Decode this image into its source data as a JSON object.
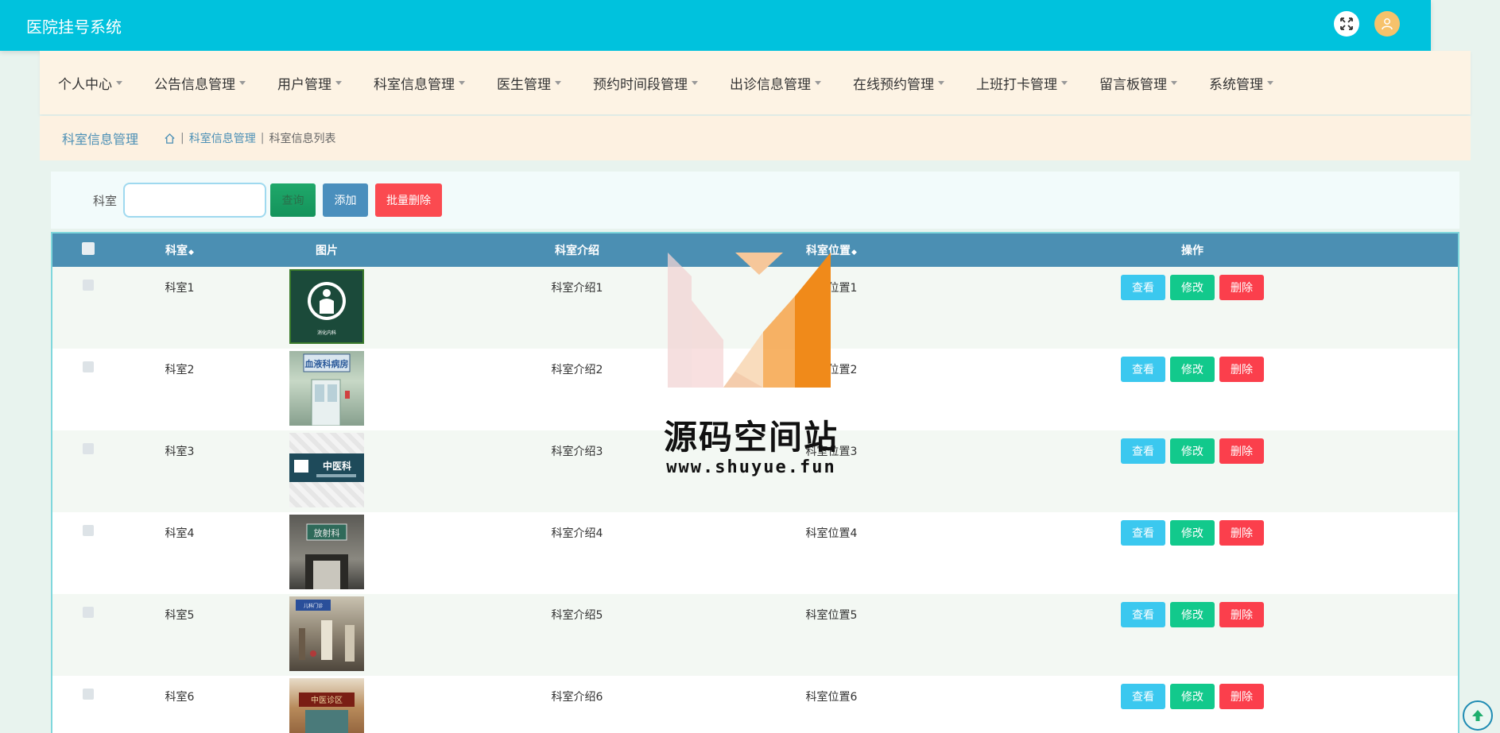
{
  "header": {
    "app_title": "医院挂号系统"
  },
  "menu": {
    "items": [
      {
        "label": "个人中心"
      },
      {
        "label": "公告信息管理"
      },
      {
        "label": "用户管理"
      },
      {
        "label": "科室信息管理"
      },
      {
        "label": "医生管理"
      },
      {
        "label": "预约时间段管理"
      },
      {
        "label": "出诊信息管理"
      },
      {
        "label": "在线预约管理"
      },
      {
        "label": "上班打卡管理"
      },
      {
        "label": "留言板管理"
      },
      {
        "label": "系统管理"
      }
    ]
  },
  "breadcrumb": {
    "title": "科室信息管理",
    "level1": "科室信息管理",
    "current": "科室信息列表"
  },
  "search": {
    "label": "科室",
    "value": "",
    "placeholder": "",
    "query_label": "查询",
    "add_label": "添加",
    "batch_delete_label": "批量删除"
  },
  "table": {
    "columns": [
      "科室",
      "图片",
      "科室介绍",
      "科室位置",
      "操作"
    ],
    "rows": [
      {
        "name": "科室1",
        "intro": "科室介绍1",
        "location": "科室位置1"
      },
      {
        "name": "科室2",
        "intro": "科室介绍2",
        "location": "科室位置2"
      },
      {
        "name": "科室3",
        "intro": "科室介绍3",
        "location": "科室位置3"
      },
      {
        "name": "科室4",
        "intro": "科室介绍4",
        "location": "科室位置4"
      },
      {
        "name": "科室5",
        "intro": "科室介绍5",
        "location": "科室位置5"
      },
      {
        "name": "科室6",
        "intro": "科室介绍6",
        "location": "科室位置6"
      }
    ],
    "actions": {
      "view": "查看",
      "edit": "修改",
      "delete": "删除"
    },
    "image_texts": {
      "r1": "消化内科",
      "r2": "血液科病房",
      "r3": "中医科",
      "r4": "放射科",
      "r5": "儿科门诊",
      "r6": "中医诊区"
    }
  },
  "watermark": {
    "text": "源码空间站",
    "url": "www.shuyue.fun"
  },
  "colors": {
    "header": "#00c2dd",
    "table_header": "#4b8fb3",
    "view": "#3bc8ef",
    "edit": "#12c98c",
    "delete": "#fb3f4c"
  }
}
